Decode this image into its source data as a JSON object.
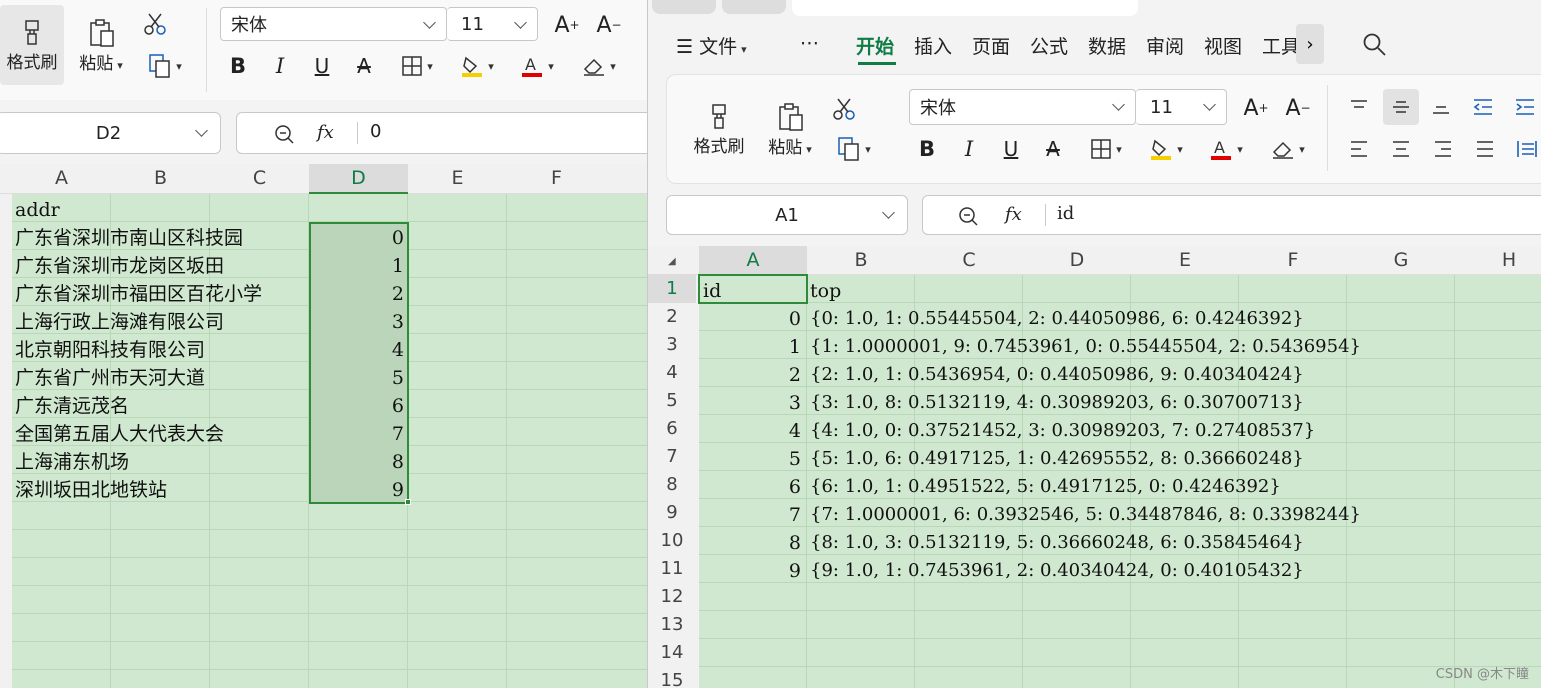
{
  "left": {
    "ribbon": {
      "format_painter": "格式刷",
      "paste": "粘贴",
      "font_name": "宋体",
      "font_size": "11"
    },
    "name_box": "D2",
    "fx": "fx",
    "formula": "0",
    "columns": [
      "A",
      "B",
      "C",
      "D",
      "E",
      "F"
    ],
    "header": "addr",
    "addresses": [
      "广东省深圳市南山区科技园",
      "广东省深圳市龙岗区坂田",
      "广东省深圳市福田区百花小学",
      "上海行政上海滩有限公司",
      "北京朝阳科技有限公司",
      "广东省广州市天河大道",
      "广东清远茂名",
      "全国第五届人大代表大会",
      "上海浦东机场",
      "深圳坂田北地铁站"
    ],
    "ids": [
      "0",
      "1",
      "2",
      "3",
      "4",
      "5",
      "6",
      "7",
      "8",
      "9"
    ]
  },
  "right": {
    "menu": {
      "more": "⋯",
      "file": "文件",
      "tabs": [
        "开始",
        "插入",
        "页面",
        "公式",
        "数据",
        "审阅",
        "视图",
        "工具"
      ],
      "active_tab": "开始"
    },
    "ribbon": {
      "format_painter": "格式刷",
      "paste": "粘贴",
      "font_name": "宋体",
      "font_size": "11"
    },
    "name_box": "A1",
    "fx": "fx",
    "formula": "id",
    "columns": [
      "A",
      "B",
      "C",
      "D",
      "E",
      "F",
      "G",
      "H"
    ],
    "row_numbers": [
      "1",
      "2",
      "3",
      "4",
      "5",
      "6",
      "7",
      "8",
      "9",
      "10",
      "11",
      "12",
      "13",
      "14",
      "15"
    ],
    "header": [
      "id",
      "top"
    ],
    "rows": [
      [
        "0",
        "{0: 1.0, 1: 0.55445504, 2: 0.44050986, 6: 0.4246392}"
      ],
      [
        "1",
        "{1: 1.0000001, 9: 0.7453961, 0: 0.55445504, 2: 0.5436954}"
      ],
      [
        "2",
        "{2: 1.0, 1: 0.5436954, 0: 0.44050986, 9: 0.40340424}"
      ],
      [
        "3",
        "{3: 1.0, 8: 0.5132119, 4: 0.30989203, 6: 0.30700713}"
      ],
      [
        "4",
        "{4: 1.0, 0: 0.37521452, 3: 0.30989203, 7: 0.27408537}"
      ],
      [
        "5",
        "{5: 1.0, 6: 0.4917125, 1: 0.42695552, 8: 0.36660248}"
      ],
      [
        "6",
        "{6: 1.0, 1: 0.4951522, 5: 0.4917125, 0: 0.4246392}"
      ],
      [
        "7",
        "{7: 1.0000001, 6: 0.3932546, 5: 0.34487846, 8: 0.3398244}"
      ],
      [
        "8",
        "{8: 1.0, 3: 0.5132119, 5: 0.36660248, 6: 0.35845464}"
      ],
      [
        "9",
        "{9: 1.0, 1: 0.7453961, 2: 0.40340424, 0: 0.40105432}"
      ]
    ]
  },
  "watermark": "CSDN @木下瞳",
  "colors": {
    "sheet_bg": "#cfe8cf",
    "selection": "#2e8b3a",
    "accent": "#0f7b45"
  }
}
